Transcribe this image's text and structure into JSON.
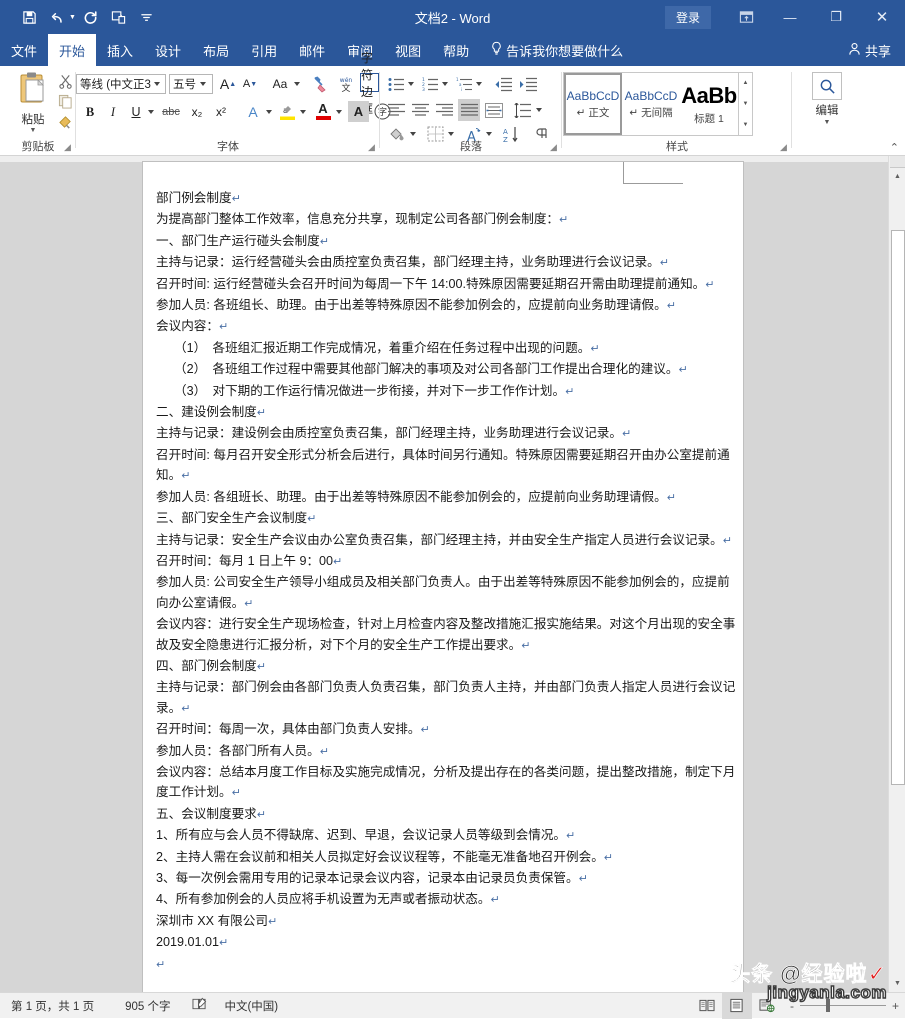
{
  "titlebar": {
    "document_title": "文档2  -  Word",
    "quick_access": [
      {
        "name": "save-icon",
        "label": "保存"
      },
      {
        "name": "undo-icon",
        "label": "撤消"
      },
      {
        "name": "redo-icon",
        "label": "恢复"
      },
      {
        "name": "touch-mode-icon",
        "label": "触摸/鼠标模式"
      },
      {
        "name": "customize-qat-icon",
        "label": "自定义快速访问工具栏"
      }
    ],
    "signin_label": "登录",
    "ribbon_display_label": "功能区显示选项",
    "minimize_label": "—",
    "restore_label": "❐",
    "close_label": "✕"
  },
  "tabs": [
    {
      "label": "文件",
      "active": false
    },
    {
      "label": "开始",
      "active": true
    },
    {
      "label": "插入",
      "active": false
    },
    {
      "label": "设计",
      "active": false
    },
    {
      "label": "布局",
      "active": false
    },
    {
      "label": "引用",
      "active": false
    },
    {
      "label": "邮件",
      "active": false
    },
    {
      "label": "审阅",
      "active": false
    },
    {
      "label": "视图",
      "active": false
    },
    {
      "label": "帮助",
      "active": false
    }
  ],
  "tell_me": "告诉我你想要做什么",
  "share_label": "共享",
  "ribbon": {
    "groups": [
      {
        "name": "clipboard",
        "label": "剪贴板"
      },
      {
        "name": "font",
        "label": "字体"
      },
      {
        "name": "paragraph",
        "label": "段落"
      },
      {
        "name": "styles",
        "label": "样式"
      },
      {
        "name": "editing",
        "label": "编辑"
      }
    ],
    "clipboard": {
      "paste_label": "粘贴",
      "cut_label": "剪切",
      "copy_label": "复制",
      "format_painter_label": "格式刷"
    },
    "font": {
      "font_name": "等线 (中文正3",
      "font_size": "五号",
      "grow_font": "A",
      "shrink_font": "A",
      "change_case": "Aa",
      "clear_format_label": "清除所有格式",
      "phonetic_label": "拼音指南",
      "char_border_label": "字符边框",
      "bold": "B",
      "italic": "I",
      "underline": "U",
      "strikethrough": "abc",
      "subscript": "x₂",
      "superscript": "x²",
      "text_effects": "A",
      "highlight": "ab",
      "font_color": "A",
      "char_shading_label": "字符底纹",
      "enclose_char": "字"
    },
    "paragraph": {
      "bullets_label": "项目符号",
      "numbering_label": "编号",
      "multilevel_label": "多级列表",
      "decrease_indent_label": "减少缩进量",
      "increase_indent_label": "增加缩进量",
      "align_left_label": "左对齐",
      "align_center_label": "居中",
      "align_right_label": "右对齐",
      "justify_label": "两端对齐",
      "distribute_label": "分散对齐",
      "line_spacing_label": "行和段落间距",
      "shading_label": "底纹",
      "borders_label": "边框",
      "aa_label": "中文版式",
      "sort_label": "排序",
      "show_marks_label": "显示/隐藏编辑标记"
    },
    "styles": {
      "items": [
        {
          "preview": "AaBbCcD",
          "name": "正文",
          "selected": true
        },
        {
          "preview": "AaBbCcD",
          "name": "无间隔",
          "selected": false
        },
        {
          "preview": "AaBb",
          "name": "标题 1",
          "selected": false
        }
      ]
    },
    "editing": {
      "label": "编辑",
      "icon": "magnifier-icon"
    },
    "collapse_label": "折叠功能区"
  },
  "document": {
    "paragraphs": [
      {
        "text": "部门例会制度",
        "indent": false
      },
      {
        "text": "为提高部门整体工作效率，信息充分共享，现制定公司各部门例会制度：",
        "indent": false
      },
      {
        "text": "一、部门生产运行碰头会制度",
        "indent": false
      },
      {
        "text": "主持与记录：运行经营碰头会由质控室负责召集，部门经理主持，业务助理进行会议记录。",
        "indent": false
      },
      {
        "text": "召开时间: 运行经营碰头会召开时间为每周一下午 14:00.特殊原因需要延期召开需由助理提前通知。",
        "indent": false
      },
      {
        "text": "参加人员: 各班组长、助理。由于出差等特殊原因不能参加例会的，应提前向业务助理请假。",
        "indent": false
      },
      {
        "text": "会议内容：",
        "indent": false
      },
      {
        "text": "（1）　各班组汇报近期工作完成情况，着重介绍在任务过程中出现的问题。",
        "indent": true
      },
      {
        "text": "（2）　各班组工作过程中需要其他部门解决的事项及对公司各部门工作提出合理化的建议。",
        "indent": true
      },
      {
        "text": "（3）　对下期的工作运行情况做进一步衔接，并对下一步工作作计划。",
        "indent": true,
        "misspell": "作"
      },
      {
        "text": "二、建设例会制度",
        "indent": false
      },
      {
        "text": "主持与记录：建设例会由质控室负责召集，部门经理主持，业务助理进行会议记录。",
        "indent": false
      },
      {
        "text": "召开时间: 每月召开安全形式分析会后进行，具体时间另行通知。特殊原因需要延期召开由办公室提前通知。",
        "indent": false
      },
      {
        "text": "参加人员: 各组班长、助理。由于出差等特殊原因不能参加例会的，应提前向业务助理请假。",
        "indent": false
      },
      {
        "text": "三、部门安全生产会议制度",
        "indent": false
      },
      {
        "text": "主持与记录：安全生产会议由办公室负责召集，部门经理主持，并由安全生产指定人员进行会议记录。",
        "indent": false
      },
      {
        "text": "召开时间：每月 1 日上午 9：00",
        "indent": false
      },
      {
        "text": "参加人员: 公司安全生产领导小组成员及相关部门负责人。由于出差等特殊原因不能参加例会的，应提前向办公室请假。",
        "indent": false
      },
      {
        "text": "会议内容：进行安全生产现场检查，针对上月检查内容及整改措施汇报实施结果。对这个月出现的安全事故及安全隐患进行汇报分析，对下个月的安全生产工作提出要求。",
        "indent": false
      },
      {
        "text": "四、部门例会制度",
        "indent": false
      },
      {
        "text": "主持与记录：部门例会由各部门负责人负责召集，部门负责人主持，并由部门负责人指定人员进行会议记录。",
        "indent": false
      },
      {
        "text": "召开时间：每周一次，具体由部门负责人安排。",
        "indent": false
      },
      {
        "text": "参加人员：各部门所有人员。",
        "indent": false
      },
      {
        "text": "会议内容：总结本月度工作目标及实施完成情况，分析及提出存在的各类问题，提出整改措施，制定下月度工作计划。",
        "indent": false
      },
      {
        "text": "五、会议制度要求",
        "indent": false
      },
      {
        "text": "1、所有应与会人员不得缺席、迟到、早退，会议记录人员等级到会情况。",
        "indent": false
      },
      {
        "text": "2、主持人需在会议前和相关人员拟定好会议议程等，不能毫无准备地召开例会。",
        "indent": false
      },
      {
        "text": "3、每一次例会需用专用的记录本记录会议内容，记录本由记录员负责保管。",
        "indent": false
      },
      {
        "text": "4、所有参加例会的人员应将手机设置为无声或者振动状态。",
        "indent": false
      },
      {
        "text": "深圳市 XX 有限公司",
        "indent": false
      },
      {
        "text": "2019.01.01",
        "indent": false
      }
    ]
  },
  "statusbar": {
    "page_info": "第 1 页，共 1 页",
    "word_count": "905 个字",
    "proofing_label": "校对",
    "language": "中文(中国)",
    "view_read_label": "阅读视图",
    "view_print_label": "页面视图",
    "view_web_label": "Web 版式视图",
    "zoom_out": "-",
    "zoom_in": "+"
  },
  "watermark": {
    "line1": "头条 @经验啦",
    "check": "✓",
    "line2": "jingyanla.com"
  },
  "colors": {
    "word_blue": "#2b579a",
    "accent": "#2b579a",
    "doc_bg": "#d6d6d6",
    "status_bg": "#f1f1f1"
  }
}
